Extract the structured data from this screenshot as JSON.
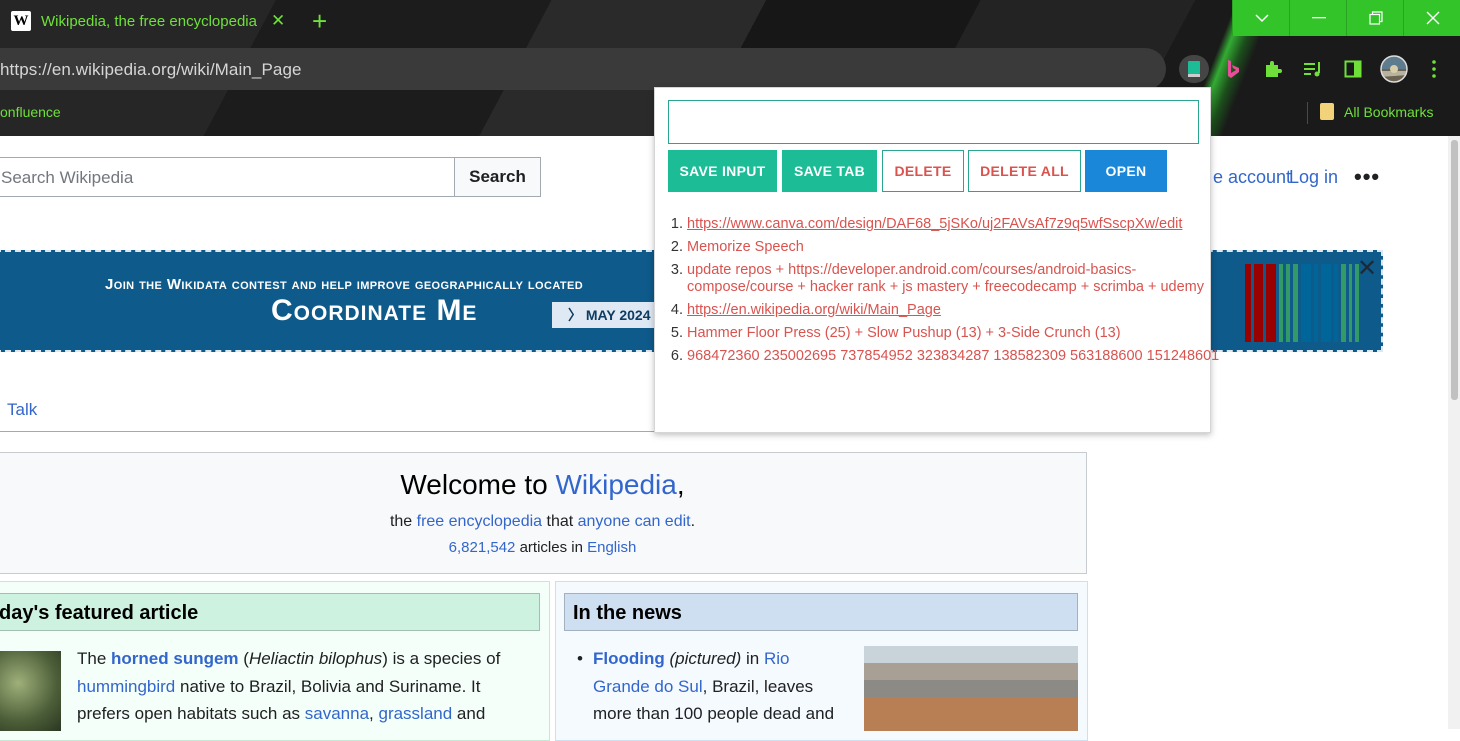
{
  "browser": {
    "tab_title": "Wikipedia, the free encyclopedia",
    "url": "https://en.wikipedia.org/wiki/Main_Page",
    "bookmark_left": "onfluence",
    "bookmark_right": "All Bookmarks",
    "favicon_letter": "W",
    "accent": "#33c42a"
  },
  "wiki": {
    "search_placeholder": "Search Wikipedia",
    "search_button": "Search",
    "create_account": "e account",
    "login": "Log in",
    "more": "•••",
    "banner": {
      "line1": "Join the Wikidata contest and help improve geographically located",
      "line2": "Coordinate Me",
      "pill": "〉 MAY 2024",
      "close": "✕"
    },
    "talk_tab": "Talk",
    "welcome": {
      "title_pre": "Welcome to ",
      "title_link": "Wikipedia",
      "title_post": ",",
      "sub_pre": "the ",
      "sub_link1": "free encyclopedia",
      "sub_mid": " that ",
      "sub_link2": "anyone can edit",
      "sub_post": ".",
      "count": "6,821,542",
      "count_mid": " articles in ",
      "lang": "English"
    },
    "featured": {
      "heading": "day's featured article",
      "t1": "The ",
      "l1": "horned sungem",
      "t2": " (",
      "i1": "Heliactin bilophus",
      "t3": ") is a species of ",
      "l2": "hummingbird",
      "t4": " native to Brazil, Bolivia and Suriname. It prefers open habitats such as ",
      "l3": "savanna",
      "t5": ", ",
      "l4": "grassland",
      "t6": " and"
    },
    "news": {
      "heading": "In the news",
      "l1": "Flooding",
      "i1": " (pictured)",
      "t1": " in ",
      "l2": "Rio Grande do Sul",
      "t2": ", Brazil, leaves more than 100 people dead and"
    }
  },
  "popup": {
    "input_value": "",
    "buttons": {
      "save_input": "SAVE INPUT",
      "save_tab": "SAVE TAB",
      "delete": "DELETE",
      "delete_all": "DELETE ALL",
      "open": "OPEN"
    },
    "items": [
      "https://www.canva.com/design/DAF68_5jSKo/uj2FAVsAf7z9q5wfSscpXw/edit",
      "Memorize Speech",
      "update repos + https://developer.android.com/courses/android-basics-compose/course + hacker rank + js mastery + freecodecamp + scrimba + udemy",
      "https://en.wikipedia.org/wiki/Main_Page",
      "Hammer Floor Press (25) + Slow Pushup (13) + 3-Side Crunch (13)",
      "968472360 235002695 737854952 323834287 138582309 563188600 151248601"
    ],
    "colors": {
      "green": "#1cbc97",
      "blue": "#1a87d9",
      "red": "#d9534f"
    }
  }
}
